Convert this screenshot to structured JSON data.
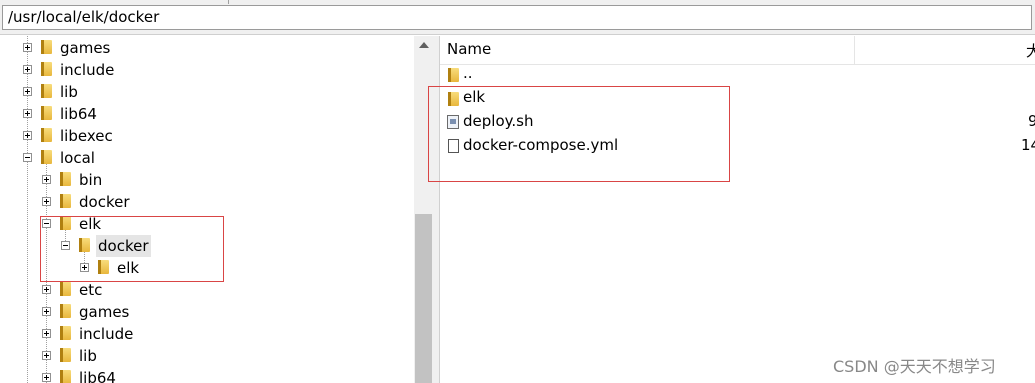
{
  "path_bar": {
    "value": "/usr/local/elk/docker"
  },
  "tree": [
    {
      "label": "games",
      "expander": "plus"
    },
    {
      "label": "include",
      "expander": "plus"
    },
    {
      "label": "lib",
      "expander": "plus"
    },
    {
      "label": "lib64",
      "expander": "plus"
    },
    {
      "label": "libexec",
      "expander": "plus"
    },
    {
      "label": "local",
      "expander": "minus"
    },
    {
      "label": "bin",
      "expander": "plus"
    },
    {
      "label": "docker",
      "expander": "plus"
    },
    {
      "label": "elk",
      "expander": "minus"
    },
    {
      "label": "docker",
      "expander": "minus",
      "selected": true
    },
    {
      "label": "elk",
      "expander": "plus"
    },
    {
      "label": "etc",
      "expander": "plus"
    },
    {
      "label": "games",
      "expander": "plus"
    },
    {
      "label": "include",
      "expander": "plus"
    },
    {
      "label": "lib",
      "expander": "plus"
    },
    {
      "label": "lib64",
      "expander": "plus"
    }
  ],
  "file_list": {
    "columns": {
      "name": "Name",
      "size": "大"
    },
    "rows": [
      {
        "name": "..",
        "icon": "folder-up-icon",
        "size": ""
      },
      {
        "name": "elk",
        "icon": "folder-icon",
        "size": ""
      },
      {
        "name": "deploy.sh",
        "icon": "script-file-icon",
        "size": "9"
      },
      {
        "name": "docker-compose.yml",
        "icon": "document-file-icon",
        "size": "14"
      }
    ]
  },
  "highlight_color": "#d94545",
  "watermark": "CSDN @天天不想学习"
}
